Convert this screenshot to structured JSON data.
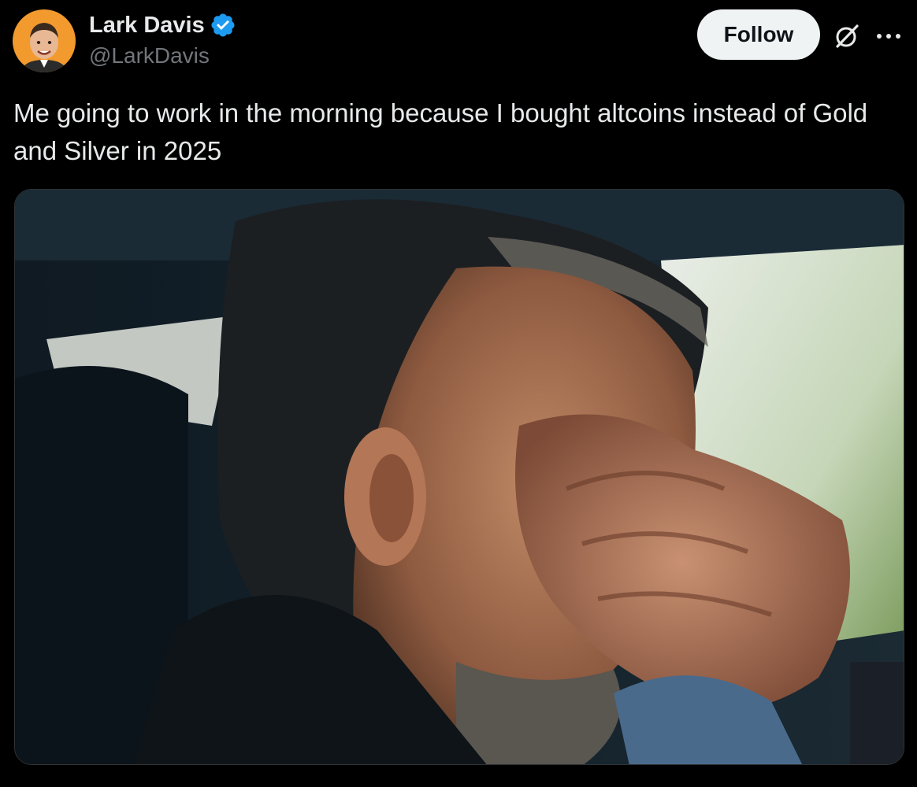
{
  "author": {
    "display_name": "Lark Davis",
    "handle": "@LarkDavis",
    "verified": true,
    "avatar_icon": "avatar-photo"
  },
  "actions": {
    "follow_label": "Follow",
    "grok_icon": "grok-icon",
    "more_icon": "more-dots-icon"
  },
  "tweet": {
    "text": "Me going to work in the morning because I bought altcoins instead of Gold and Silver in 2025"
  },
  "media": {
    "type": "gif-still",
    "icon": "media-image"
  },
  "colors": {
    "background": "#000000",
    "text_primary": "#e7e9ea",
    "text_secondary": "#71767b",
    "verified_blue": "#1d9bf0",
    "follow_bg": "#eff3f4",
    "follow_text": "#0f1419",
    "border": "#2f3336"
  }
}
